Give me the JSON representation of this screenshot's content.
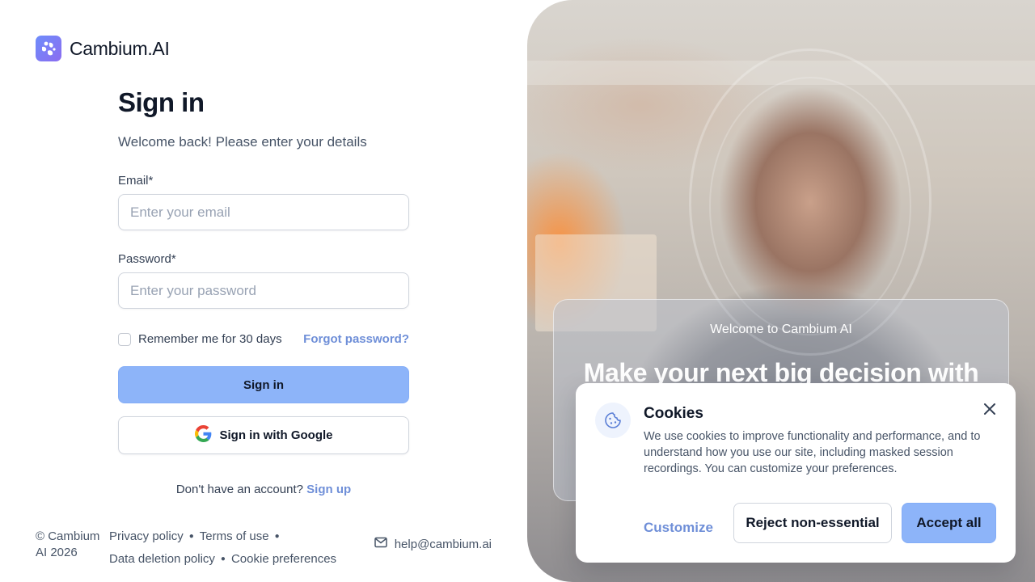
{
  "brand": {
    "name": "Cambium.AI",
    "logo_icon": "cambium-logo-icon",
    "accent": "#8db4f9",
    "link_color": "#6f8fd8"
  },
  "signin": {
    "title": "Sign in",
    "subtitle": "Welcome back! Please enter your details",
    "email_label": "Email*",
    "email_placeholder": "Enter your email",
    "email_value": "",
    "password_label": "Password*",
    "password_placeholder": "Enter your password",
    "password_value": "",
    "remember_label": "Remember me for 30 days",
    "remember_checked": false,
    "forgot_label": "Forgot password?",
    "submit_label": "Sign in",
    "google_label": "Sign in with Google",
    "google_icon": "google-icon",
    "no_account_text": "Don't have an account?",
    "signup_label": "Sign up"
  },
  "footer": {
    "copyright": "© Cambium AI 2026",
    "links": [
      "Privacy policy",
      "Terms of use",
      "Data deletion policy",
      "Cookie preferences"
    ],
    "email_icon": "mail-icon",
    "email": "help@cambium.ai"
  },
  "hero": {
    "label": "Welcome to Cambium AI",
    "headline": "Make your next big decision with"
  },
  "cookies": {
    "icon": "cookie-icon",
    "title": "Cookies",
    "text": "We use cookies to improve functionality and performance, and to understand how you use our site, including masked session recordings. You can customize your preferences.",
    "close_icon": "close-icon",
    "customize_label": "Customize",
    "reject_label": "Reject non-essential",
    "accept_label": "Accept all"
  }
}
